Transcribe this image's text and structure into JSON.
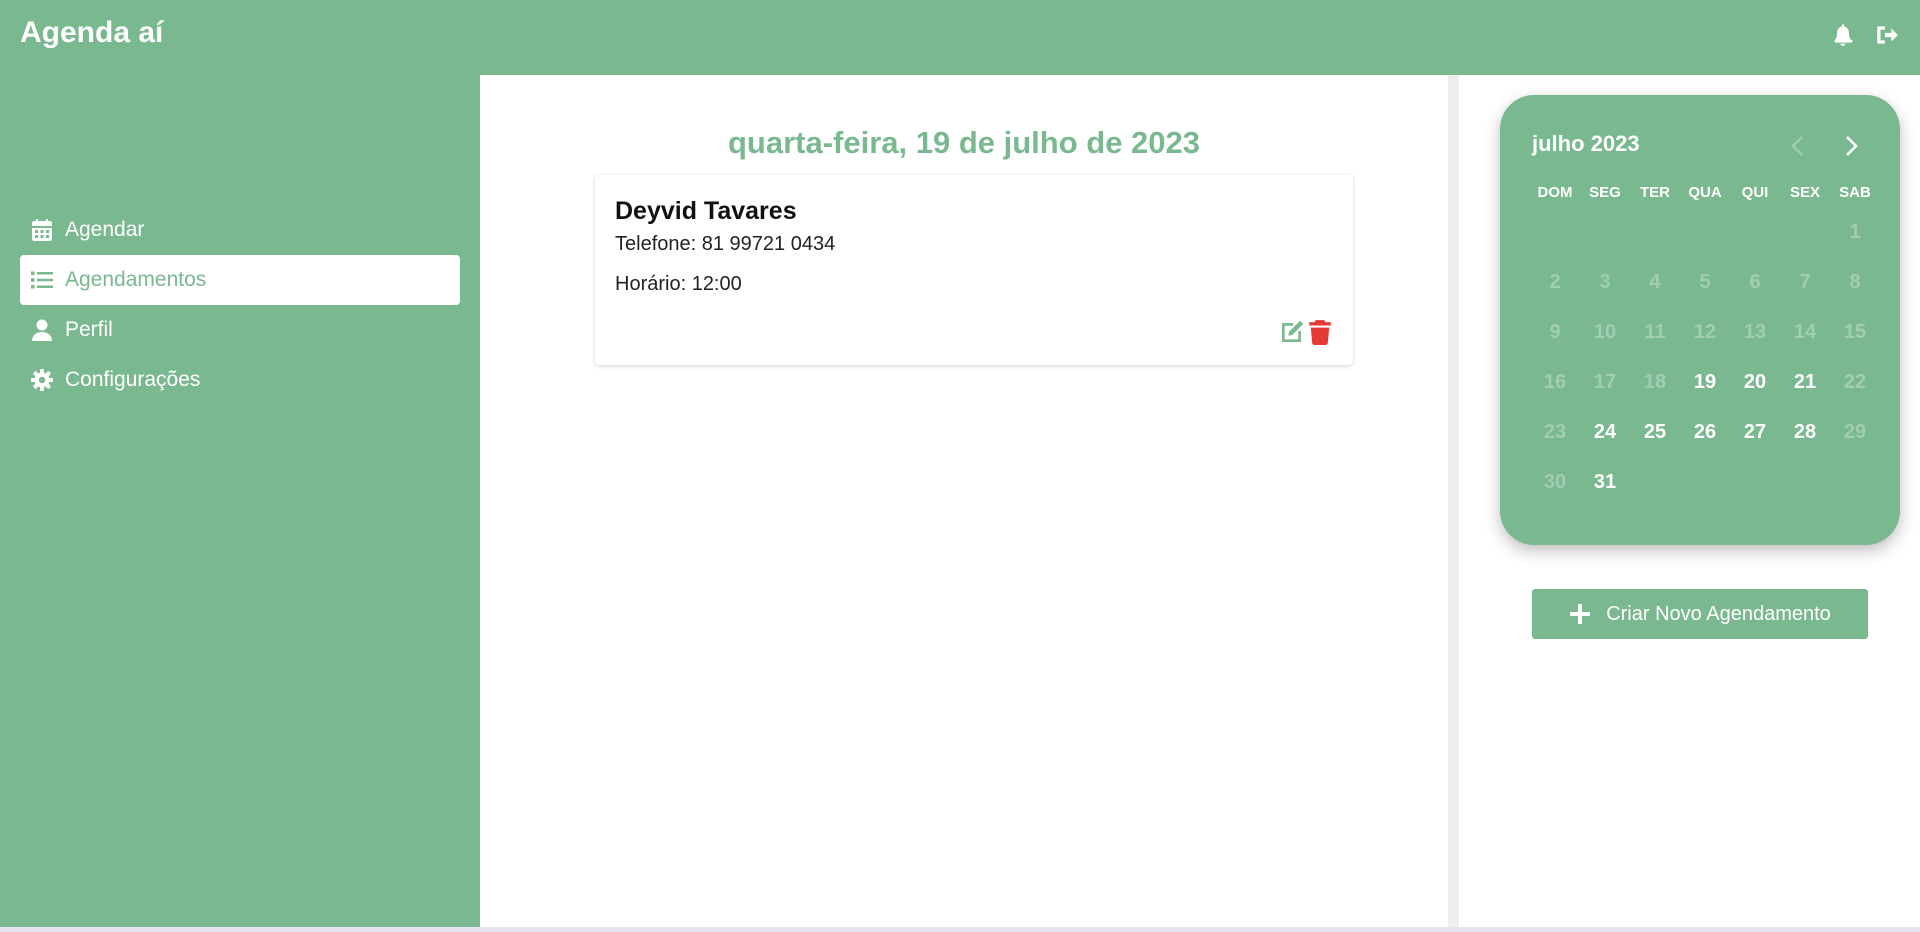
{
  "header": {
    "title": "Agenda aí",
    "icons": [
      "bell-icon",
      "sign-out-icon"
    ]
  },
  "sidebar": {
    "items": [
      {
        "label": "Agendar",
        "icon": "calendar-icon",
        "active": false
      },
      {
        "label": "Agendamentos",
        "icon": "list-icon",
        "active": true
      },
      {
        "label": "Perfil",
        "icon": "user-icon",
        "active": false
      },
      {
        "label": "Configurações",
        "icon": "gear-icon",
        "active": false
      }
    ]
  },
  "main": {
    "date_title": "quarta-feira, 19 de julho de 2023",
    "appointment": {
      "name": "Deyvid Tavares",
      "phone": "Telefone: 81 99721 0434",
      "time": "Horário: 12:00",
      "actions": [
        "edit-icon",
        "trash-icon"
      ]
    }
  },
  "calendar": {
    "month_label": "julho 2023",
    "weekdays": [
      "DOM",
      "SEG",
      "TER",
      "QUA",
      "QUI",
      "SEX",
      "SAB"
    ],
    "leading_blank_days": 6,
    "days": [
      {
        "d": "1",
        "enabled": false
      },
      {
        "d": "2",
        "enabled": false
      },
      {
        "d": "3",
        "enabled": false
      },
      {
        "d": "4",
        "enabled": false
      },
      {
        "d": "5",
        "enabled": false
      },
      {
        "d": "6",
        "enabled": false
      },
      {
        "d": "7",
        "enabled": false
      },
      {
        "d": "8",
        "enabled": false
      },
      {
        "d": "9",
        "enabled": false
      },
      {
        "d": "10",
        "enabled": false
      },
      {
        "d": "11",
        "enabled": false
      },
      {
        "d": "12",
        "enabled": false
      },
      {
        "d": "13",
        "enabled": false
      },
      {
        "d": "14",
        "enabled": false
      },
      {
        "d": "15",
        "enabled": false
      },
      {
        "d": "16",
        "enabled": false
      },
      {
        "d": "17",
        "enabled": false
      },
      {
        "d": "18",
        "enabled": false
      },
      {
        "d": "19",
        "enabled": true
      },
      {
        "d": "20",
        "enabled": true
      },
      {
        "d": "21",
        "enabled": true
      },
      {
        "d": "22",
        "enabled": false
      },
      {
        "d": "23",
        "enabled": false
      },
      {
        "d": "24",
        "enabled": true
      },
      {
        "d": "25",
        "enabled": true
      },
      {
        "d": "26",
        "enabled": true
      },
      {
        "d": "27",
        "enabled": true
      },
      {
        "d": "28",
        "enabled": true
      },
      {
        "d": "29",
        "enabled": false
      },
      {
        "d": "30",
        "enabled": false
      },
      {
        "d": "31",
        "enabled": true
      }
    ],
    "prev_enabled": false,
    "next_enabled": true
  },
  "actions": {
    "new_appointment_label": "Criar Novo Agendamento"
  },
  "colors": {
    "brand": "#7ab890",
    "delete": "#e53935",
    "dim_day": "#a3cdb2"
  }
}
